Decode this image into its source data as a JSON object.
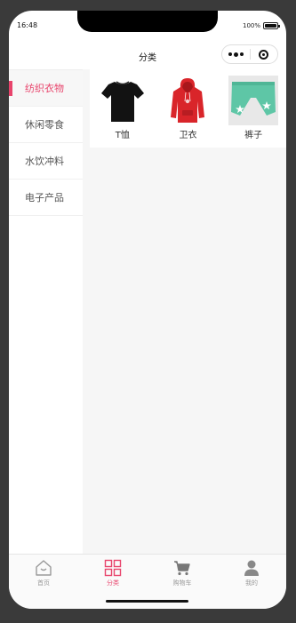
{
  "status_bar": {
    "time": "16:48",
    "battery": "100%"
  },
  "navbar": {
    "title": "分类"
  },
  "sidebar": {
    "items": [
      {
        "label": "纺织衣物",
        "active": true
      },
      {
        "label": "休闲零食",
        "active": false
      },
      {
        "label": "水饮冲料",
        "active": false
      },
      {
        "label": "电子产品",
        "active": false
      }
    ]
  },
  "products": [
    {
      "label": "T恤",
      "icon": "tshirt-image"
    },
    {
      "label": "卫衣",
      "icon": "hoodie-image"
    },
    {
      "label": "裤子",
      "icon": "pants-image"
    }
  ],
  "tabbar": {
    "items": [
      {
        "label": "首页",
        "icon": "home-icon",
        "active": false
      },
      {
        "label": "分类",
        "icon": "category-grid-icon",
        "active": true
      },
      {
        "label": "购物车",
        "icon": "cart-icon",
        "active": false
      },
      {
        "label": "我的",
        "icon": "user-icon",
        "active": false
      }
    ]
  },
  "colors": {
    "accent": "#e8446c",
    "inactive": "#999999",
    "background": "#f6f6f6"
  }
}
